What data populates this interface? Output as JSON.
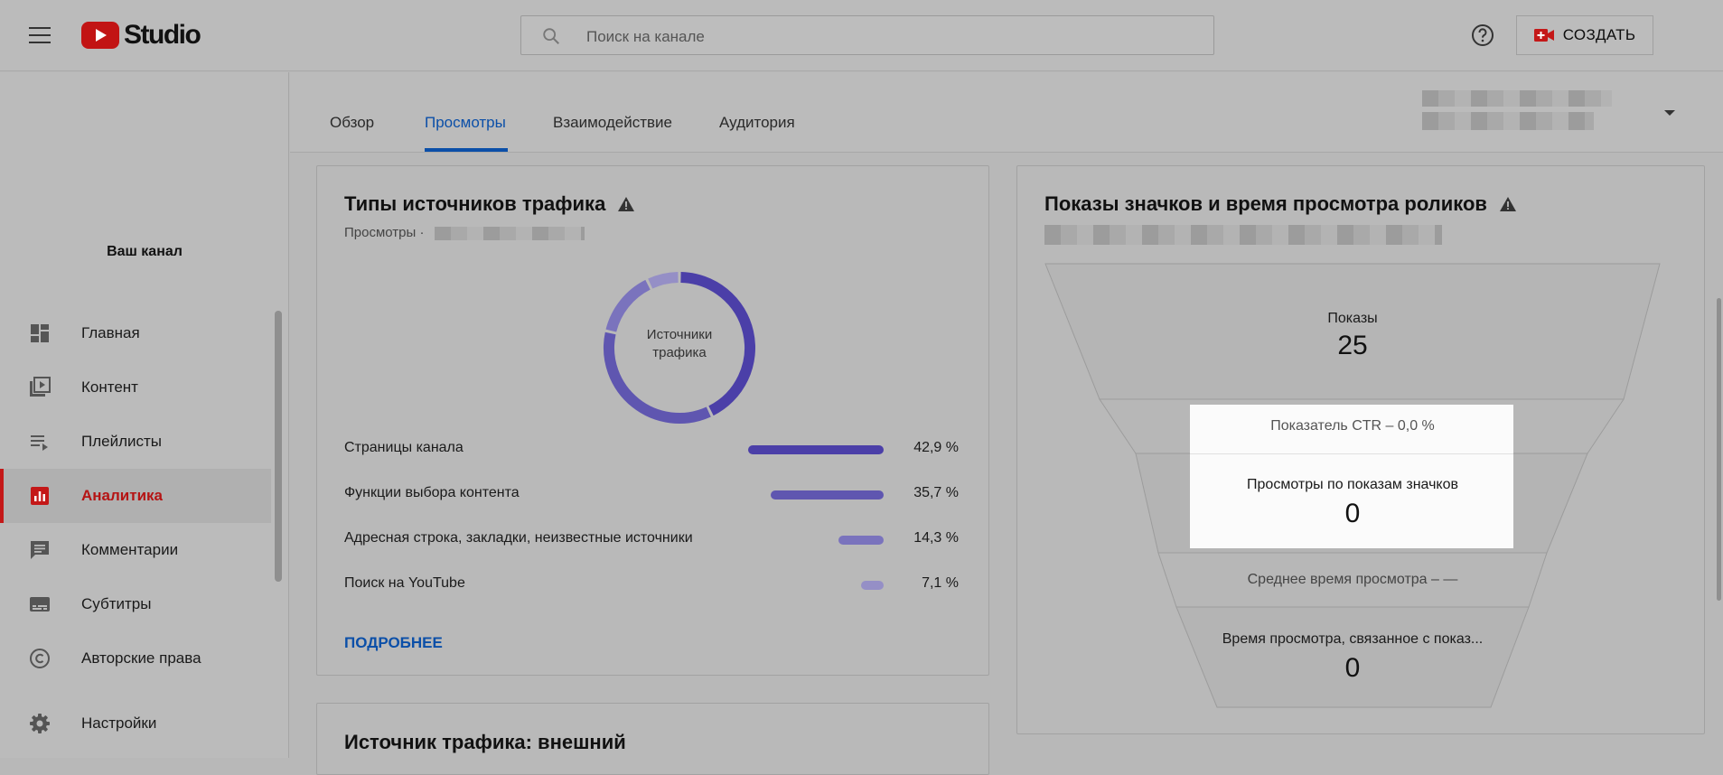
{
  "header": {
    "logo_text": "Studio",
    "search_placeholder": "Поиск на канале",
    "create_label": "СОЗДАТЬ"
  },
  "sidebar": {
    "channel_label": "Ваш канал",
    "items": [
      {
        "label": "Главная",
        "icon": "dashboard-icon"
      },
      {
        "label": "Контент",
        "icon": "video-library-icon"
      },
      {
        "label": "Плейлисты",
        "icon": "playlist-icon"
      },
      {
        "label": "Аналитика",
        "icon": "analytics-icon",
        "active": true
      },
      {
        "label": "Комментарии",
        "icon": "comment-icon"
      },
      {
        "label": "Субтитры",
        "icon": "subtitles-icon"
      },
      {
        "label": "Авторские права",
        "icon": "copyright-icon"
      },
      {
        "label": "Настройки",
        "icon": "gear-icon"
      }
    ]
  },
  "tabs": [
    {
      "label": "Обзор"
    },
    {
      "label": "Просмотры",
      "active": true
    },
    {
      "label": "Взаимодействие"
    },
    {
      "label": "Аудитория"
    }
  ],
  "traffic_card": {
    "title": "Типы источников трафика",
    "subtitle": "Просмотры ·",
    "donut_label": "Источники трафика",
    "sources": [
      {
        "name": "Страницы канала",
        "value": 42.9,
        "pct": "42,9 %",
        "color": "#4b3fa8"
      },
      {
        "name": "Функции выбора контента",
        "value": 35.7,
        "pct": "35,7 %",
        "color": "#5f56b0"
      },
      {
        "name": "Адресная строка, закладки, неизвестные источники",
        "value": 14.3,
        "pct": "14,3 %",
        "color": "#7a73bd"
      },
      {
        "name": "Поиск на YouTube",
        "value": 7.1,
        "pct": "7,1 %",
        "color": "#958fc6"
      }
    ],
    "more_label": "ПОДРОБНЕЕ"
  },
  "external_card": {
    "title": "Источник трафика: внешний"
  },
  "funnel_card": {
    "title": "Показы значков и время просмотра роликов",
    "impressions_label": "Показы",
    "impressions_value": "25",
    "ctr_label": "Показатель CTR – 0,0 %",
    "views_label": "Просмотры по показам значков",
    "views_value": "0",
    "avg_label": "Среднее время просмотра – —",
    "watch_label": "Время просмотра, связанное с показ...",
    "watch_value": "0"
  }
}
